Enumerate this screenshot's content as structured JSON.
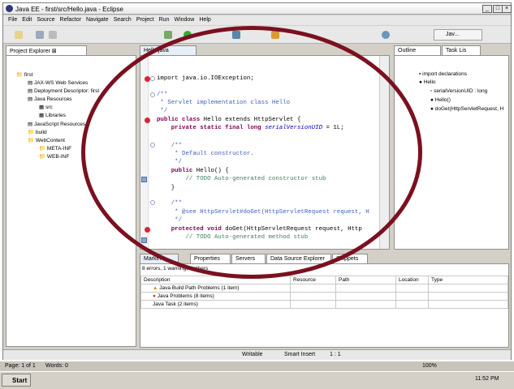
{
  "window": {
    "title": "Java EE - first/src/Hello.java - Eclipse"
  },
  "menu": [
    "File",
    "Edit",
    "Source",
    "Refactor",
    "Navigate",
    "Search",
    "Project",
    "Run",
    "Window",
    "Help"
  ],
  "perspective": {
    "label": "Jav..."
  },
  "project_explorer": {
    "tab": "Project Explorer",
    "items": [
      "first",
      "JAX-WS Web Services",
      "Deployment Descriptor: first",
      "Java Resources",
      "src",
      "Libraries",
      "JavaScript Resources",
      "build",
      "WebContent",
      "META-INF",
      "WEB-INF"
    ]
  },
  "editor": {
    "tab": "Hello.java",
    "lines": {
      "import": "import java.io.IOException;",
      "c1": "/**",
      "c2": " * Servlet implementation class Hello",
      "c3": " */",
      "l_class_kw": "public class ",
      "l_class_rest": "Hello extends HttpServlet {",
      "l_field_kw": "    private static final long ",
      "l_field_name": "serialVersionUID",
      "l_field_rest": " = 1L;",
      "c4": "    /**",
      "c5": "     * Default constructor.",
      "c6": "     */",
      "l_ctor_kw": "    public ",
      "l_ctor_rest": "Hello() {",
      "l_todo1": "        // TODO Auto-generated constructor stub",
      "l_close": "    }",
      "c7": "    /**",
      "c8": "     * @see HttpServlet#doGet(HttpServletRequest request, H",
      "c9": "     */",
      "l_doget_kw": "    protected void ",
      "l_doget_rest": "doGet(HttpServletRequest request, Http",
      "l_todo2": "        // TODO Auto-generated method stub"
    }
  },
  "outline": {
    "tab": "Outline",
    "tab2": "Task Lis",
    "items": [
      "import declarations",
      "Hello",
      "serialVersionUID : long",
      "Hello()",
      "doGet(HttpServletRequest, H"
    ]
  },
  "bottom": {
    "tabs": [
      "Markers",
      "Properties",
      "Servers",
      "Data Source Explorer",
      "Snippets"
    ],
    "summary": "8 errors, 1 warning, 2 others",
    "columns": [
      "Description",
      "Resource",
      "Path",
      "Location",
      "Type"
    ],
    "rows": [
      "Java Build Path Problems (1 item)",
      "Java Problems (8 items)",
      "Java Task (2 items)"
    ]
  },
  "status": {
    "writable": "Writable",
    "insert": "Smart Insert",
    "pos": "1 : 1"
  },
  "page_bar": {
    "page": "Page: 1 of 1",
    "words": "Words: 0",
    "zoom": "100%"
  },
  "taskbar": {
    "start": "Start",
    "time": "11:52 PM"
  }
}
